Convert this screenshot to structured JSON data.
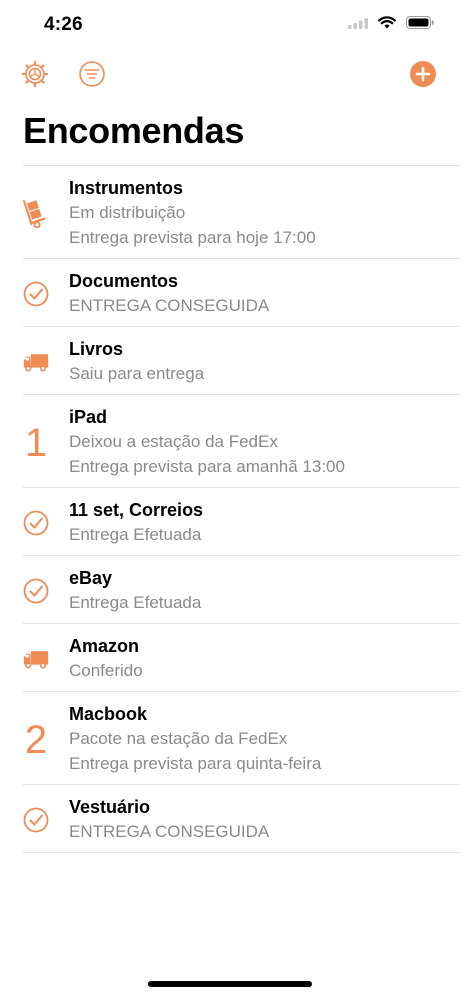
{
  "status_bar": {
    "time": "4:26"
  },
  "colors": {
    "accent": "#EF8B55",
    "secondary_text": "#8A8A8E",
    "divider": "#E3E3E6"
  },
  "toolbar": {
    "settings_icon": "gear-icon",
    "filter_icon": "filter-icon",
    "add_icon": "plus-circle-icon"
  },
  "header": {
    "title": "Encomendas"
  },
  "packages": [
    {
      "icon": "hand-truck-icon",
      "title": "Instrumentos",
      "lines": [
        "Em distribuição",
        "Entrega prevista para hoje 17:00"
      ]
    },
    {
      "icon": "checkmark-circle-icon",
      "title": "Documentos",
      "lines": [
        "ENTREGA CONSEGUIDA"
      ]
    },
    {
      "icon": "delivery-truck-icon",
      "title": "Livros",
      "lines": [
        "Saiu para entrega"
      ]
    },
    {
      "icon": "days-count",
      "badge": "1",
      "title": "iPad",
      "lines": [
        "Deixou a estação da FedEx",
        "Entrega prevista para amanhã 13:00"
      ]
    },
    {
      "icon": "checkmark-circle-icon",
      "title": "11 set, Correios",
      "lines": [
        "Entrega Efetuada"
      ]
    },
    {
      "icon": "checkmark-circle-icon",
      "title": "eBay",
      "lines": [
        "Entrega Efetuada"
      ]
    },
    {
      "icon": "delivery-truck-icon",
      "title": "Amazon",
      "lines": [
        "Conferido"
      ]
    },
    {
      "icon": "days-count",
      "badge": "2",
      "title": "Macbook",
      "lines": [
        "Pacote na estação da FedEx",
        "Entrega prevista para quinta-feira"
      ]
    },
    {
      "icon": "checkmark-circle-icon",
      "title": "Vestuário",
      "lines": [
        "ENTREGA CONSEGUIDA"
      ]
    }
  ]
}
